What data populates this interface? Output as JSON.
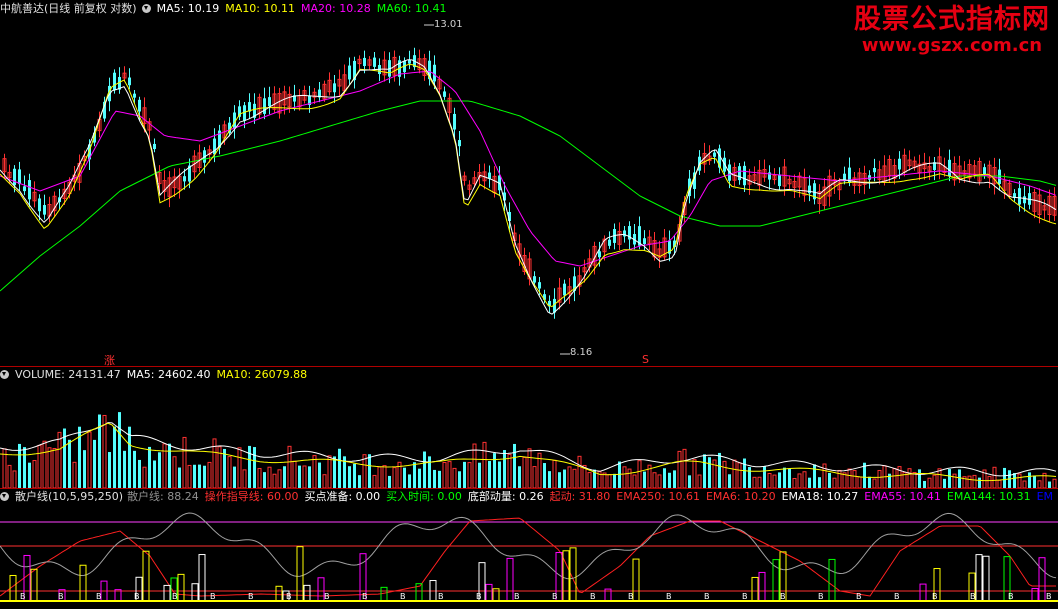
{
  "main_header": {
    "stock": "中航善达(日线 前复权 对数)",
    "ma5": "MA5: 10.19",
    "ma10": "MA10: 10.11",
    "ma20": "MA20: 10.28",
    "ma60": "MA60: 10.41"
  },
  "main_chart": {
    "high_label": "13.01",
    "low_label": "8.16",
    "zhang_marker": "涨",
    "s_marker": "S"
  },
  "volume_header": {
    "title": "VOLUME: 24131.47",
    "ma5": "MA5: 24602.40",
    "ma10": "MA10: 26079.88"
  },
  "indicator_header": {
    "name": "散户线(10,5,95,250)",
    "v1": "散户线: 88.24",
    "v2": "操作指导线: 60.00",
    "v3": "买点准备: 0.00",
    "v4": "买入时间: 0.00",
    "v5": "底部动量: 0.26",
    "v6": "起动: 31.80",
    "v7": "EMA250: 10.61",
    "v8": "EMA6: 10.20",
    "v9": "EMA18: 10.27",
    "v10": "EMA55: 10.41",
    "v11": "EMA144: 10.31",
    "v12": "EM"
  },
  "watermark": {
    "line1": "股票公式指标网",
    "line2": "www.gszx.com.cn"
  },
  "colors": {
    "up": "#ff3232",
    "down": "#54ffff",
    "ma5": "#ffffff",
    "ma10": "#ffff00",
    "ma20": "#ff00ff",
    "ma60": "#00ff00",
    "divider": "#b00000"
  }
}
